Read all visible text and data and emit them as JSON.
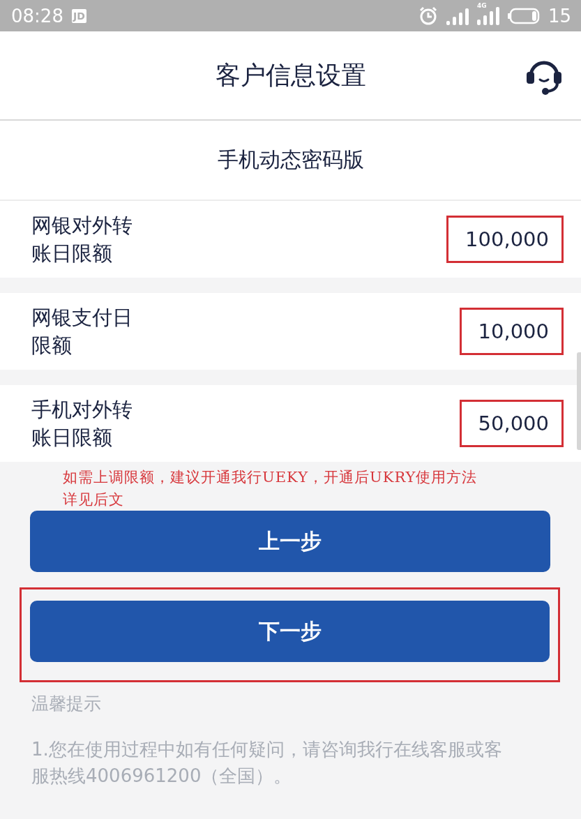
{
  "status_bar": {
    "time": "08:28",
    "notification_badge": "JD",
    "network_type": "4G",
    "battery_percent": "15"
  },
  "header": {
    "title": "客户信息设置"
  },
  "section": {
    "title": "手机动态密码版"
  },
  "limits": [
    {
      "label": "网银对外转账日限额",
      "value": "100,000",
      "highlighted": true
    },
    {
      "label": "网银支付日限额",
      "value": "10,000",
      "highlighted": true
    },
    {
      "label": "手机对外转账日限额",
      "value": "50,000",
      "highlighted": true
    }
  ],
  "note": "如需上调限额，建议开通我行UEKY，开通后UKRY使用方法详见后文",
  "buttons": [
    {
      "label": "上一步",
      "highlighted": false
    },
    {
      "label": "下一步",
      "highlighted": true
    }
  ],
  "tips": {
    "title": "温馨提示",
    "items": [
      "1.您在使用过程中如有任何疑问，请咨询我行在线客服或客服热线4006961200（全国）。"
    ]
  }
}
